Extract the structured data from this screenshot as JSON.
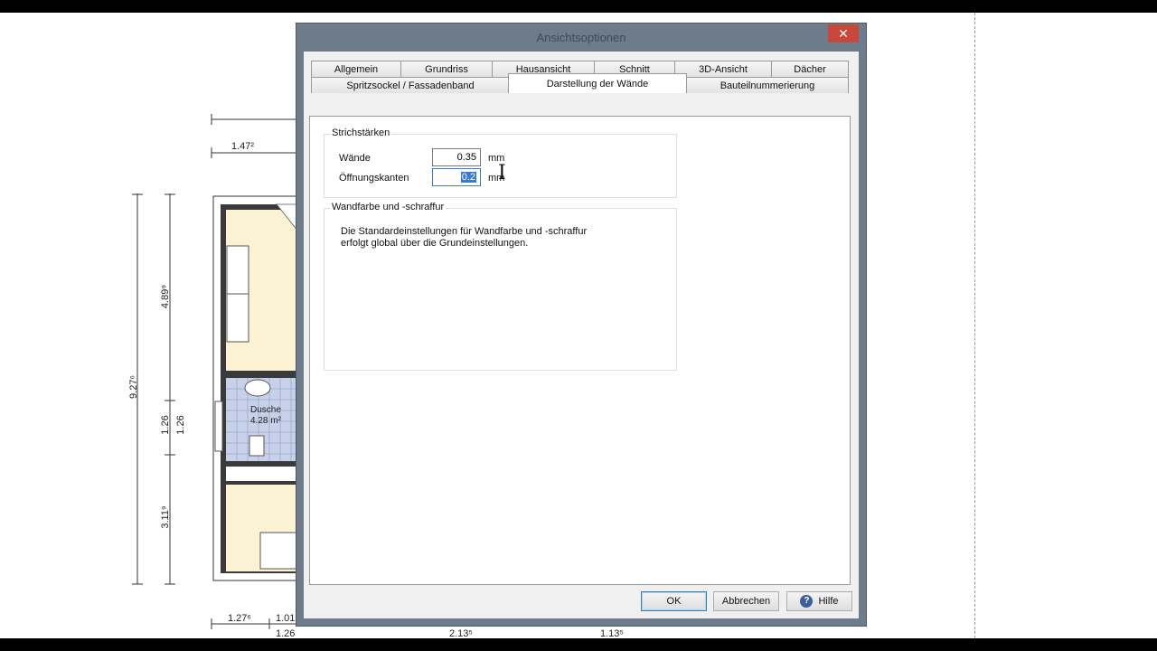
{
  "dialog": {
    "title": "Ansichtsoptionen",
    "close_label": "✕",
    "tabs_row1": [
      "Allgemein",
      "Grundriss",
      "Hausansicht",
      "Schnitt",
      "3D-Ansicht",
      "Dächer"
    ],
    "tabs_row2": [
      "Spritzsockel / Fassadenband",
      "Darstellung der Wände",
      "Bauteilnummerierung"
    ],
    "active_tab": "Darstellung der Wände",
    "strichstaerken": {
      "title": "Strichstärken",
      "waende_label": "Wände",
      "waende_value": "0.35",
      "oeffnung_label": "Öffnungskanten",
      "oeffnung_value": "0.2",
      "unit": "mm"
    },
    "wandfarbe": {
      "title": "Wandfarbe und -schraffur",
      "line1": "Die Standardeinstellungen für Wandfarbe und -schraffur",
      "line2": "erfolgt global über die Grundeinstellungen."
    },
    "buttons": {
      "ok": "OK",
      "cancel": "Abbrechen",
      "help": "Hilfe",
      "help_icon": "?"
    }
  },
  "plan": {
    "dims": {
      "top1": "1.47²",
      "left_total": "9.27⁶",
      "left_a": "4.89⁹",
      "left_b": "1.26",
      "left_b2": "1.26",
      "left_c": "3.11⁹",
      "bottom_a": "1.27⁶",
      "bottom_b": "1.01",
      "bottom_c": "1.26",
      "bottom_d": "2.13⁵",
      "bottom_e": "1.13⁵"
    },
    "room_name": "Dusche",
    "room_area": "4.28 m²"
  }
}
